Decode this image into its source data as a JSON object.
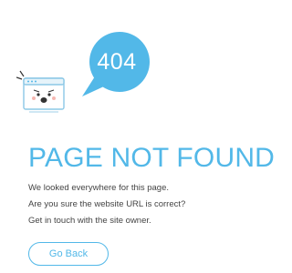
{
  "illustration": {
    "bubble_text": "404",
    "bubble_color": "#52b8e8",
    "browser_icon": "sad-browser-window-icon"
  },
  "main": {
    "title": "PAGE NOT FOUND",
    "lines": [
      "We looked everywhere for this page.",
      "Are you sure the website URL is correct?",
      "Get in touch with the site owner."
    ],
    "go_back_label": "Go Back"
  },
  "colors": {
    "accent": "#52b8e8",
    "text": "#444444",
    "background": "#ffffff"
  }
}
